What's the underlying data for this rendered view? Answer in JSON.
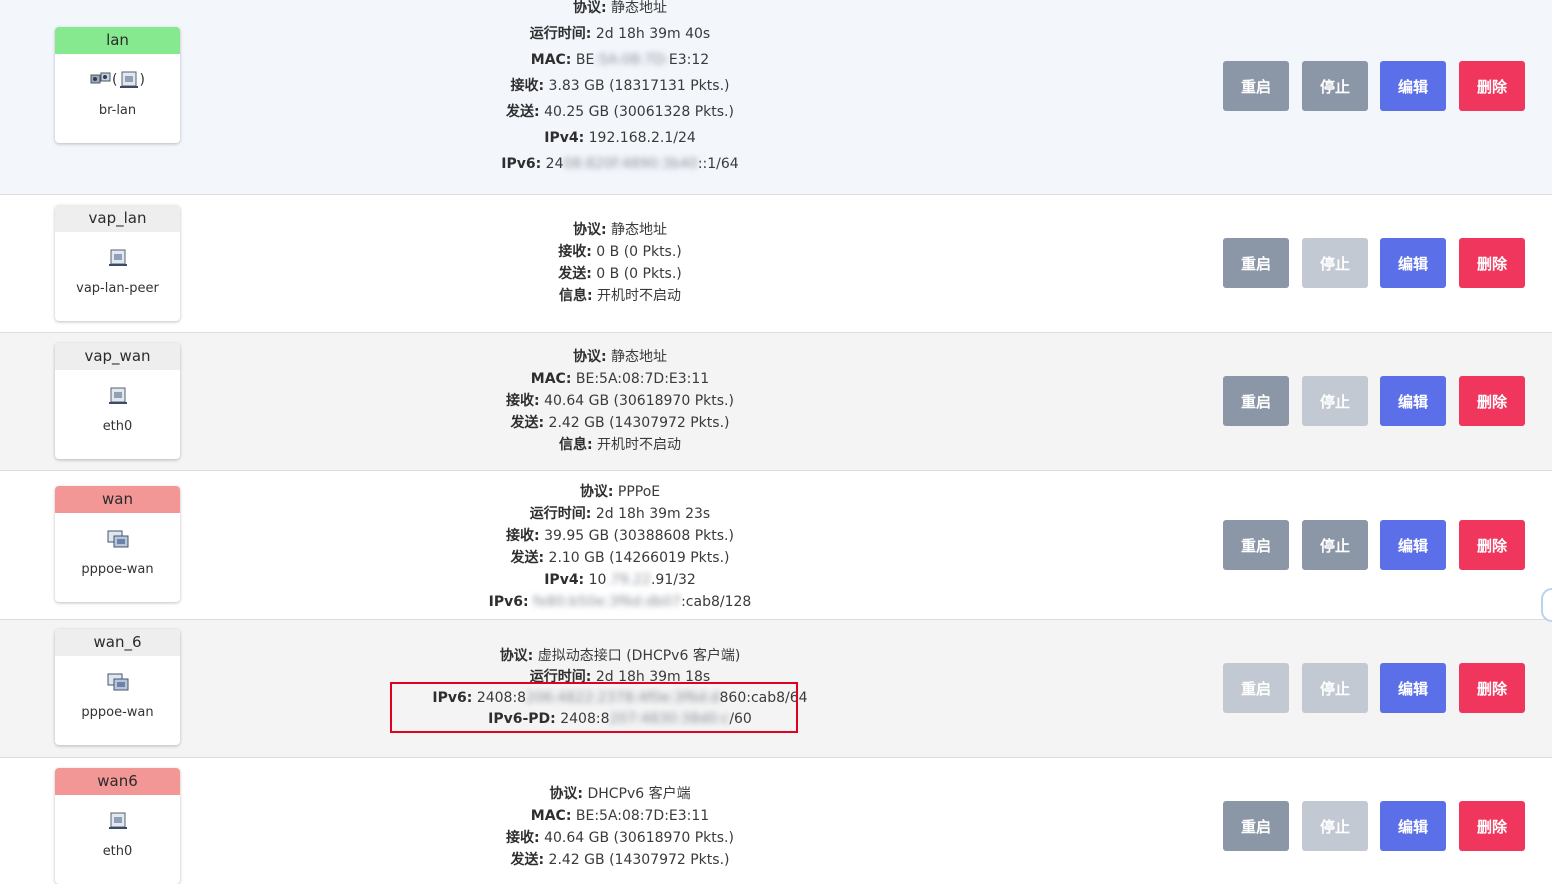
{
  "colors": {
    "restart": "#8b96a6",
    "stop_enabled": "#8b96a6",
    "stop_disabled": "#c3c9d2",
    "restart_disabled": "#c3c9d2",
    "edit": "#5b6fe8",
    "delete": "#f0365c",
    "lan_head": "#86e990",
    "wan_head": "#f29696",
    "neutral_head": "#eeeeee",
    "highlight": "#e1001f"
  },
  "buttons": {
    "restart": "重启",
    "stop": "停止",
    "edit": "编辑",
    "delete": "删除"
  },
  "interfaces": [
    {
      "name": "lan",
      "device": "br-lan",
      "icons": "bridge-icon",
      "bridge_paren_open": "(",
      "bridge_paren_close": ")",
      "restart_enabled": true,
      "stop_enabled": true,
      "info": [
        {
          "label": "协议:",
          "value": "静态地址"
        },
        {
          "label": "运行时间:",
          "value": "2d 18h 39m 40s"
        },
        {
          "label": "MAC:",
          "value_pre": "BE",
          "value_blur": ":5A:08:7D:",
          "value_post": "E3:12"
        },
        {
          "label": "接收:",
          "value": "3.83 GB (18317131 Pkts.)"
        },
        {
          "label": "发送:",
          "value": "40.25 GB (30061328 Pkts.)"
        },
        {
          "label": "IPv4:",
          "value": "192.168.2.1/24"
        },
        {
          "label": "IPv6:",
          "value_pre": "24",
          "value_blur": "08:820f:4890:3b40",
          "value_post": "::1/64"
        }
      ]
    },
    {
      "name": "vap_lan",
      "device": "vap-lan-peer",
      "icons": "ethernet-port-icon",
      "restart_enabled": true,
      "stop_enabled": false,
      "info": [
        {
          "label": "协议:",
          "value": "静态地址"
        },
        {
          "label": "接收:",
          "value": "0 B (0 Pkts.)"
        },
        {
          "label": "发送:",
          "value": "0 B (0 Pkts.)"
        },
        {
          "label": "信息:",
          "value": "开机时不启动"
        }
      ]
    },
    {
      "name": "vap_wan",
      "device": "eth0",
      "icons": "ethernet-port-icon",
      "restart_enabled": true,
      "stop_enabled": false,
      "info": [
        {
          "label": "协议:",
          "value": "静态地址"
        },
        {
          "label": "MAC:",
          "value": "BE:5A:08:7D:E3:11"
        },
        {
          "label": "接收:",
          "value": "40.64 GB (30618970 Pkts.)"
        },
        {
          "label": "发送:",
          "value": "2.42 GB (14307972 Pkts.)"
        },
        {
          "label": "信息:",
          "value": "开机时不启动"
        }
      ]
    },
    {
      "name": "wan",
      "device": "pppoe-wan",
      "icons": "tunnel-icon",
      "restart_enabled": true,
      "stop_enabled": true,
      "info": [
        {
          "label": "协议:",
          "value": "PPPoE"
        },
        {
          "label": "运行时间:",
          "value": "2d 18h 39m 23s"
        },
        {
          "label": "接收:",
          "value": "39.95 GB (30388608 Pkts.)"
        },
        {
          "label": "发送:",
          "value": "2.10 GB (14266019 Pkts.)"
        },
        {
          "label": "IPv4:",
          "value_pre": "10",
          "value_blur": ".79.22",
          "value_post": ".91/32"
        },
        {
          "label": "IPv6:",
          "value_pre": "",
          "value_blur": "fe80:b50e:3f6d:db07",
          "value_post": ":cab8/128"
        }
      ]
    },
    {
      "name": "wan_6",
      "device": "pppoe-wan",
      "icons": "tunnel-icon",
      "restart_enabled": false,
      "stop_enabled": false,
      "info": [
        {
          "label": "协议:",
          "value": "虚拟动态接口 (DHCPv6 客户端)"
        },
        {
          "label": "运行时间:",
          "value": "2d 18h 39m 18s"
        },
        {
          "label": "IPv6:",
          "value_pre": "2408:8",
          "value_blur": "206:4822:2378:4f0e:3f6d:d",
          "value_post": "860:cab8/64"
        },
        {
          "label": "IPv6-PD:",
          "value_pre": "2408:8",
          "value_blur": "207:4830:38d0:c",
          "value_post": "/60"
        }
      ]
    },
    {
      "name": "wan6",
      "device": "eth0",
      "icons": "ethernet-port-icon",
      "restart_enabled": true,
      "stop_enabled": false,
      "info": [
        {
          "label": "协议:",
          "value": "DHCPv6 客户端"
        },
        {
          "label": "MAC:",
          "value": "BE:5A:08:7D:E3:11"
        },
        {
          "label": "接收:",
          "value": "40.64 GB (30618970 Pkts.)"
        },
        {
          "label": "发送:",
          "value": "2.42 GB (14307972 Pkts.)"
        }
      ]
    }
  ]
}
